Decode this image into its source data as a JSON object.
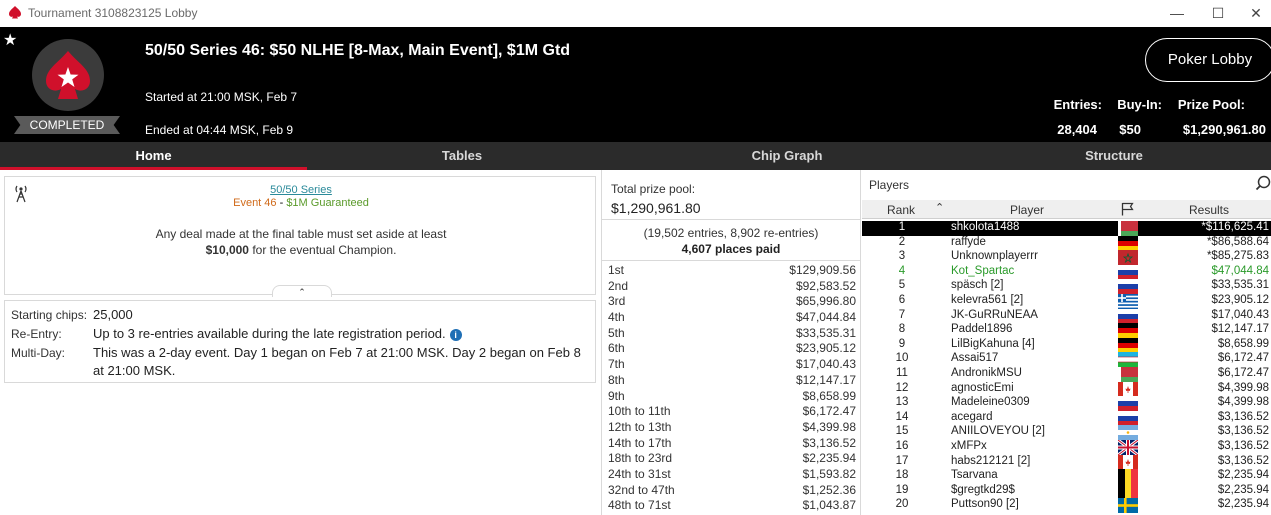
{
  "window": {
    "title": "Tournament 3108823125 Lobby"
  },
  "header": {
    "title": "50/50 Series 46: $50 NLHE [8-Max, Main Event], $1M Gtd",
    "started": "Started at 21:00 MSK, Feb 7",
    "ended": "Ended at 04:44 MSK, Feb 9",
    "status": "COMPLETED",
    "lobby_button": "Poker Lobby",
    "stats": {
      "entries_label": "Entries:",
      "entries": "28,404",
      "buyin_label": "Buy-In:",
      "buyin": "$50",
      "prizepool_label": "Prize Pool:",
      "prizepool": "$1,290,961.80"
    }
  },
  "tabs": [
    "Home",
    "Tables",
    "Chip Graph",
    "Structure"
  ],
  "info": {
    "series_link": "50/50 Series",
    "event": "Event 46",
    "separator": " - ",
    "guaranteed": "$1M Guaranteed",
    "deal_line1": "Any deal made at the final table must set aside at least",
    "deal_amount": "$10,000",
    "deal_line2": " for the eventual Champion."
  },
  "details": {
    "starting_chips_label": "Starting chips:",
    "starting_chips": "25,000",
    "reentry_label": "Re-Entry:",
    "reentry": "Up to 3 re-entries available during the late registration period.",
    "multiday_label": "Multi-Day:",
    "multiday": "This was a 2-day event. Day 1 began on Feb 7 at 21:00 MSK. Day 2 began on Feb 8 at 21:00 MSK."
  },
  "prize": {
    "total_label": "Total prize pool:",
    "total": "$1,290,961.80",
    "entries_note": "(19,502 entries, 8,902 re-entries)",
    "places_paid": "4,607 places paid",
    "payouts": [
      {
        "place": "1st",
        "amount": "$129,909.56"
      },
      {
        "place": "2nd",
        "amount": "$92,583.52"
      },
      {
        "place": "3rd",
        "amount": "$65,996.80"
      },
      {
        "place": "4th",
        "amount": "$47,044.84"
      },
      {
        "place": "5th",
        "amount": "$33,535.31"
      },
      {
        "place": "6th",
        "amount": "$23,905.12"
      },
      {
        "place": "7th",
        "amount": "$17,040.43"
      },
      {
        "place": "8th",
        "amount": "$12,147.17"
      },
      {
        "place": "9th",
        "amount": "$8,658.99"
      },
      {
        "place": "10th to 11th",
        "amount": "$6,172.47"
      },
      {
        "place": "12th to 13th",
        "amount": "$4,399.98"
      },
      {
        "place": "14th to 17th",
        "amount": "$3,136.52"
      },
      {
        "place": "18th to 23rd",
        "amount": "$2,235.94"
      },
      {
        "place": "24th to 31st",
        "amount": "$1,593.82"
      },
      {
        "place": "32nd to 47th",
        "amount": "$1,252.36"
      },
      {
        "place": "48th to 71st",
        "amount": "$1,043.87"
      }
    ]
  },
  "players": {
    "title": "Players",
    "col_rank": "Rank",
    "col_player": "Player",
    "col_results": "Results",
    "list": [
      {
        "rank": "1",
        "name": "shkolota1488",
        "result": "*$116,625.41",
        "flag": "BY"
      },
      {
        "rank": "2",
        "name": "raffyde",
        "result": "*$86,588.64",
        "flag": "DE"
      },
      {
        "rank": "3",
        "name": "Unknownplayerrr",
        "result": "*$85,275.83",
        "flag": "MA"
      },
      {
        "rank": "4",
        "name": "Kot_Spartac",
        "result": "$47,044.84",
        "flag": "RU"
      },
      {
        "rank": "5",
        "name": "späsch [2]",
        "result": "$33,535.31",
        "flag": "RU"
      },
      {
        "rank": "6",
        "name": "kelevra561 [2]",
        "result": "$23,905.12",
        "flag": "GR"
      },
      {
        "rank": "7",
        "name": "JK-GuRRuNEAA",
        "result": "$17,040.43",
        "flag": "RU"
      },
      {
        "rank": "8",
        "name": "Paddel1896",
        "result": "$12,147.17",
        "flag": "DE"
      },
      {
        "rank": "9",
        "name": "LilBigKahuna [4]",
        "result": "$8,658.99",
        "flag": "DE"
      },
      {
        "rank": "10",
        "name": "Assai517",
        "result": "$6,172.47",
        "flag": "UZ"
      },
      {
        "rank": "11",
        "name": "AndronikMSU",
        "result": "$6,172.47",
        "flag": "BY"
      },
      {
        "rank": "12",
        "name": "agnosticEmi",
        "result": "$4,399.98",
        "flag": "CA"
      },
      {
        "rank": "13",
        "name": "Madeleine0309",
        "result": "$4,399.98",
        "flag": "RU"
      },
      {
        "rank": "14",
        "name": "acegard",
        "result": "$3,136.52",
        "flag": "RU"
      },
      {
        "rank": "15",
        "name": "ANIILOVEYOU [2]",
        "result": "$3,136.52",
        "flag": "AR"
      },
      {
        "rank": "16",
        "name": "xMFPx",
        "result": "$3,136.52",
        "flag": "GB"
      },
      {
        "rank": "17",
        "name": "habs212121 [2]",
        "result": "$3,136.52",
        "flag": "CA"
      },
      {
        "rank": "18",
        "name": "Tsarvana",
        "result": "$2,235.94",
        "flag": "BE"
      },
      {
        "rank": "19",
        "name": "$gregtkd29$",
        "result": "$2,235.94",
        "flag": "BE"
      },
      {
        "rank": "20",
        "name": "Puttson90 [2]",
        "result": "$2,235.94",
        "flag": "SE"
      }
    ]
  },
  "colors": {
    "accent": "#d0102b",
    "highlight_green": "#2a9a2a"
  }
}
